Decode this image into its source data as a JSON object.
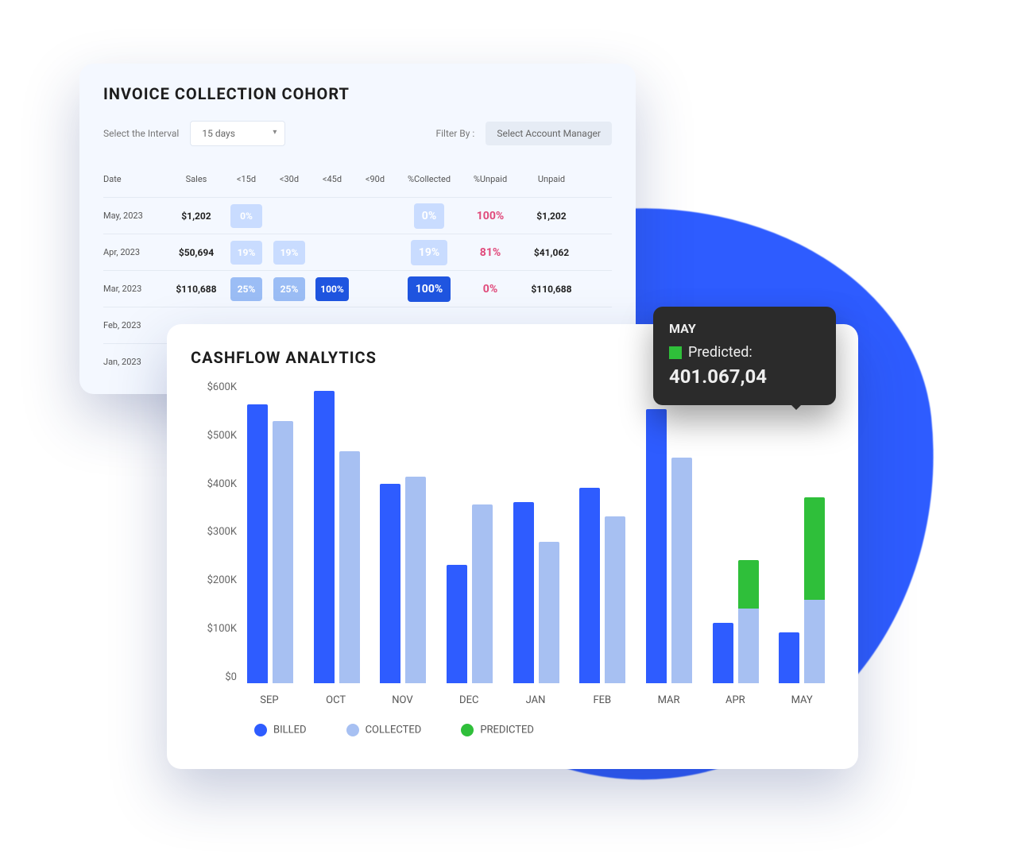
{
  "cohort": {
    "title": "INVOICE COLLECTION COHORT",
    "interval_label": "Select the Interval",
    "interval_value": "15 days",
    "filter_label": "Filter By :",
    "filter_value": "Select Account Manager",
    "columns": [
      "Date",
      "Sales",
      "<15d",
      "<30d",
      "<45d",
      "<90d",
      "%Collected",
      "%Unpaid",
      "Unpaid"
    ],
    "rows": [
      {
        "date": "May, 2023",
        "sales": "$1,202",
        "d15": "0%",
        "d30": "",
        "d45": "",
        "d90": "",
        "pct_collected": "0%",
        "pct_collected_style": "light",
        "pct_unpaid": "100%",
        "unpaid": "$1,202"
      },
      {
        "date": "Apr, 2023",
        "sales": "$50,694",
        "d15": "19%",
        "d30": "19%",
        "d45": "",
        "d90": "",
        "pct_collected": "19%",
        "pct_collected_style": "light",
        "pct_unpaid": "81%",
        "unpaid": "$41,062"
      },
      {
        "date": "Mar, 2023",
        "sales": "$110,688",
        "d15": "25%",
        "d30": "25%",
        "d45": "100%",
        "d90": "",
        "pct_collected": "100%",
        "pct_collected_style": "dark",
        "pct_unpaid": "0%",
        "unpaid": "$110,688"
      },
      {
        "date": "Feb, 2023",
        "sales": "",
        "d15": "",
        "d30": "",
        "d45": "",
        "d90": "",
        "pct_collected": "",
        "pct_collected_style": "",
        "pct_unpaid": "",
        "unpaid": ""
      },
      {
        "date": "Jan, 2023",
        "sales": "",
        "d15": "",
        "d30": "",
        "d45": "",
        "d90": "",
        "pct_collected": "",
        "pct_collected_style": "",
        "pct_unpaid": "",
        "unpaid": ""
      }
    ]
  },
  "cashflow": {
    "title": "CASHFLOW ANALYTICS",
    "y_ticks": [
      "$0",
      "$100K",
      "$200K",
      "$300K",
      "$400K",
      "$500K",
      "$600K"
    ],
    "legend": {
      "billed": "BILLED",
      "collected": "COLLECTED",
      "predicted": "PREDICTED"
    }
  },
  "tooltip": {
    "month": "MAY",
    "series_label": "Predicted:",
    "value": "401.067,04"
  },
  "chart_data": {
    "type": "bar",
    "title": "CASHFLOW ANALYTICS",
    "xlabel": "",
    "ylabel": "",
    "ylim": [
      0,
      650
    ],
    "y_unit": "$K",
    "categories": [
      "SEP",
      "OCT",
      "NOV",
      "DEC",
      "JAN",
      "FEB",
      "MAR",
      "APR",
      "MAY"
    ],
    "series": [
      {
        "name": "BILLED",
        "color": "#2e5cff",
        "values": [
          600,
          630,
          430,
          255,
          390,
          420,
          590,
          130,
          110
        ]
      },
      {
        "name": "COLLECTED",
        "color": "#a7c0f2",
        "values": [
          565,
          500,
          445,
          385,
          305,
          360,
          485,
          160,
          180
        ]
      },
      {
        "name": "PREDICTED",
        "color": "#2fbf3a",
        "stacked_on": "COLLECTED",
        "values": [
          0,
          0,
          0,
          0,
          0,
          0,
          0,
          105,
          221
        ]
      }
    ],
    "tooltip": {
      "month": "MAY",
      "series": "Predicted",
      "value": 401067.04
    }
  }
}
